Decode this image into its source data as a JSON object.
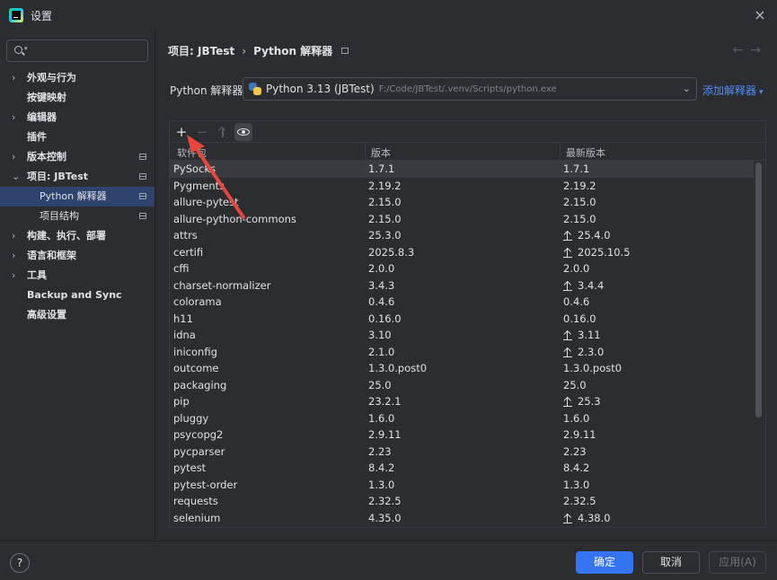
{
  "window": {
    "title": "设置",
    "close_icon": "×"
  },
  "sidebar": {
    "search_placeholder": "",
    "items": [
      {
        "label": "外观与行为",
        "chevron": "›",
        "pin": false
      },
      {
        "label": "按键映射",
        "chevron": "",
        "pin": false
      },
      {
        "label": "编辑器",
        "chevron": "›",
        "pin": false
      },
      {
        "label": "插件",
        "chevron": "",
        "pin": false
      },
      {
        "label": "版本控制",
        "chevron": "›",
        "pin": true
      },
      {
        "label": "项目: JBTest",
        "chevron": "⌄",
        "pin": true
      },
      {
        "label": "Python 解释器",
        "chevron": "",
        "pin": true,
        "sub": true,
        "selected": true
      },
      {
        "label": "项目结构",
        "chevron": "",
        "pin": true,
        "sub": true
      },
      {
        "label": "构建、执行、部署",
        "chevron": "›",
        "pin": false
      },
      {
        "label": "语言和框架",
        "chevron": "›",
        "pin": false
      },
      {
        "label": "工具",
        "chevron": "›",
        "pin": false
      },
      {
        "label": "Backup and Sync",
        "chevron": "",
        "pin": false
      },
      {
        "label": "高级设置",
        "chevron": "",
        "pin": false
      }
    ]
  },
  "breadcrumb": {
    "project": "项目: JBTest",
    "separator": "›",
    "page": "Python 解释器"
  },
  "nav_arrows": {
    "back": "←",
    "forward": "→"
  },
  "interpreter": {
    "label": "Python 解释器:",
    "name": "Python 3.13 (JBTest)",
    "path": "F:/Code/JBTest/.venv/Scripts/python.exe",
    "add_label": "添加解释器",
    "dropdown_glyph": "⌄"
  },
  "toolbar": {
    "add": "+",
    "remove": "−"
  },
  "table": {
    "headers": [
      "软件包",
      "版本",
      "最新版本"
    ],
    "rows": [
      {
        "pkg": "PySocks",
        "ver": "1.7.1",
        "latest": "1.7.1",
        "upgrade": false
      },
      {
        "pkg": "Pygments",
        "ver": "2.19.2",
        "latest": "2.19.2",
        "upgrade": false
      },
      {
        "pkg": "allure-pytest",
        "ver": "2.15.0",
        "latest": "2.15.0",
        "upgrade": false
      },
      {
        "pkg": "allure-python-commons",
        "ver": "2.15.0",
        "latest": "2.15.0",
        "upgrade": false
      },
      {
        "pkg": "attrs",
        "ver": "25.3.0",
        "latest": "25.4.0",
        "upgrade": true
      },
      {
        "pkg": "certifi",
        "ver": "2025.8.3",
        "latest": "2025.10.5",
        "upgrade": true
      },
      {
        "pkg": "cffi",
        "ver": "2.0.0",
        "latest": "2.0.0",
        "upgrade": false
      },
      {
        "pkg": "charset-normalizer",
        "ver": "3.4.3",
        "latest": "3.4.4",
        "upgrade": true
      },
      {
        "pkg": "colorama",
        "ver": "0.4.6",
        "latest": "0.4.6",
        "upgrade": false
      },
      {
        "pkg": "h11",
        "ver": "0.16.0",
        "latest": "0.16.0",
        "upgrade": false
      },
      {
        "pkg": "idna",
        "ver": "3.10",
        "latest": "3.11",
        "upgrade": true
      },
      {
        "pkg": "iniconfig",
        "ver": "2.1.0",
        "latest": "2.3.0",
        "upgrade": true
      },
      {
        "pkg": "outcome",
        "ver": "1.3.0.post0",
        "latest": "1.3.0.post0",
        "upgrade": false
      },
      {
        "pkg": "packaging",
        "ver": "25.0",
        "latest": "25.0",
        "upgrade": false
      },
      {
        "pkg": "pip",
        "ver": "23.2.1",
        "latest": "25.3",
        "upgrade": true
      },
      {
        "pkg": "pluggy",
        "ver": "1.6.0",
        "latest": "1.6.0",
        "upgrade": false
      },
      {
        "pkg": "psycopg2",
        "ver": "2.9.11",
        "latest": "2.9.11",
        "upgrade": false
      },
      {
        "pkg": "pycparser",
        "ver": "2.23",
        "latest": "2.23",
        "upgrade": false
      },
      {
        "pkg": "pytest",
        "ver": "8.4.2",
        "latest": "8.4.2",
        "upgrade": false
      },
      {
        "pkg": "pytest-order",
        "ver": "1.3.0",
        "latest": "1.3.0",
        "upgrade": false
      },
      {
        "pkg": "requests",
        "ver": "2.32.5",
        "latest": "2.32.5",
        "upgrade": false
      },
      {
        "pkg": "selenium",
        "ver": "4.35.0",
        "latest": "4.38.0",
        "upgrade": true
      }
    ]
  },
  "footer": {
    "help": "?",
    "ok": "确定",
    "cancel": "取消",
    "apply": "应用(A)"
  },
  "colors": {
    "accent": "#3574f0",
    "link": "#548af7",
    "annotation": "#e8453c",
    "selection": "#2e436e"
  }
}
